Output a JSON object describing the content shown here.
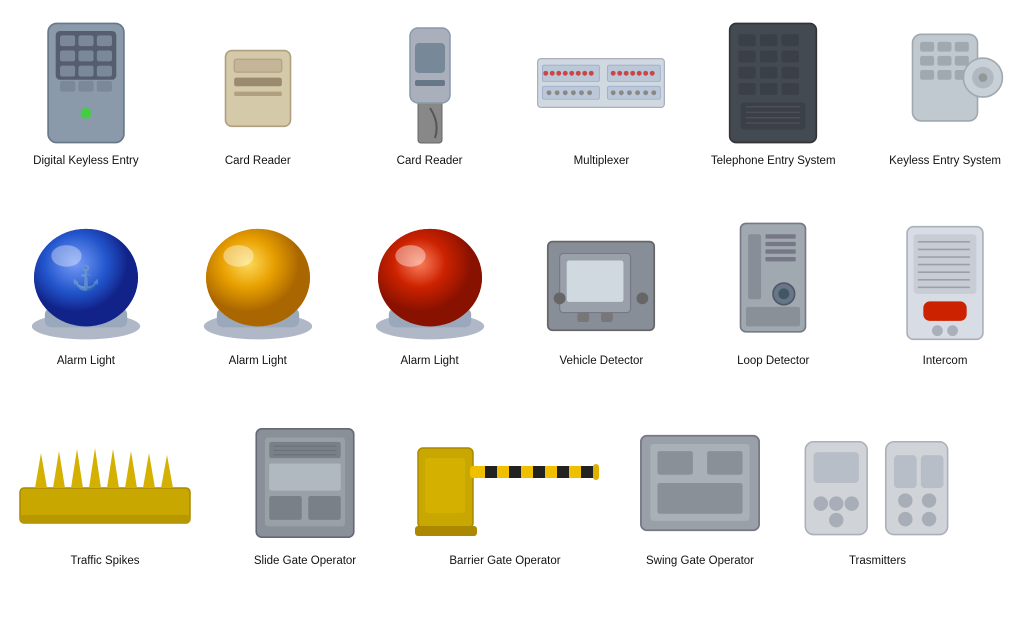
{
  "rows": [
    {
      "items": [
        {
          "name": "digital-keyless-entry",
          "label": "Digital Keyless Entry",
          "icon": "keypad"
        },
        {
          "name": "card-reader-1",
          "label": "Card Reader",
          "icon": "card-reader-flat"
        },
        {
          "name": "card-reader-2",
          "label": "Card Reader",
          "icon": "card-reader-upright"
        },
        {
          "name": "multiplexer",
          "label": "Multiplexer",
          "icon": "multiplexer"
        },
        {
          "name": "telephone-entry-system",
          "label": "Telephone Entry System",
          "icon": "telephone-entry"
        },
        {
          "name": "keyless-entry-system",
          "label": "Keyless Entry System",
          "icon": "keyless-entry"
        }
      ]
    },
    {
      "items": [
        {
          "name": "alarm-light-blue",
          "label": "Alarm Light",
          "icon": "alarm-blue"
        },
        {
          "name": "alarm-light-amber",
          "label": "Alarm Light",
          "icon": "alarm-amber"
        },
        {
          "name": "alarm-light-red",
          "label": "Alarm Light",
          "icon": "alarm-red"
        },
        {
          "name": "vehicle-detector",
          "label": "Vehicle Detector",
          "icon": "vehicle-detector"
        },
        {
          "name": "loop-detector",
          "label": "Loop Detector",
          "icon": "loop-detector"
        },
        {
          "name": "intercom",
          "label": "Intercom",
          "icon": "intercom"
        }
      ]
    },
    {
      "items": [
        {
          "name": "traffic-spikes",
          "label": "Traffic Spikes",
          "icon": "traffic-spikes"
        },
        {
          "name": "slide-gate-operator",
          "label": "Slide Gate Operator",
          "icon": "slide-gate"
        },
        {
          "name": "barrier-gate-operator",
          "label": "Barrier Gate Operator",
          "icon": "barrier-gate"
        },
        {
          "name": "swing-gate-operator",
          "label": "Swing Gate Operator",
          "icon": "swing-gate"
        },
        {
          "name": "transmitters",
          "label": "Trasmitters",
          "icon": "transmitters"
        }
      ]
    }
  ]
}
